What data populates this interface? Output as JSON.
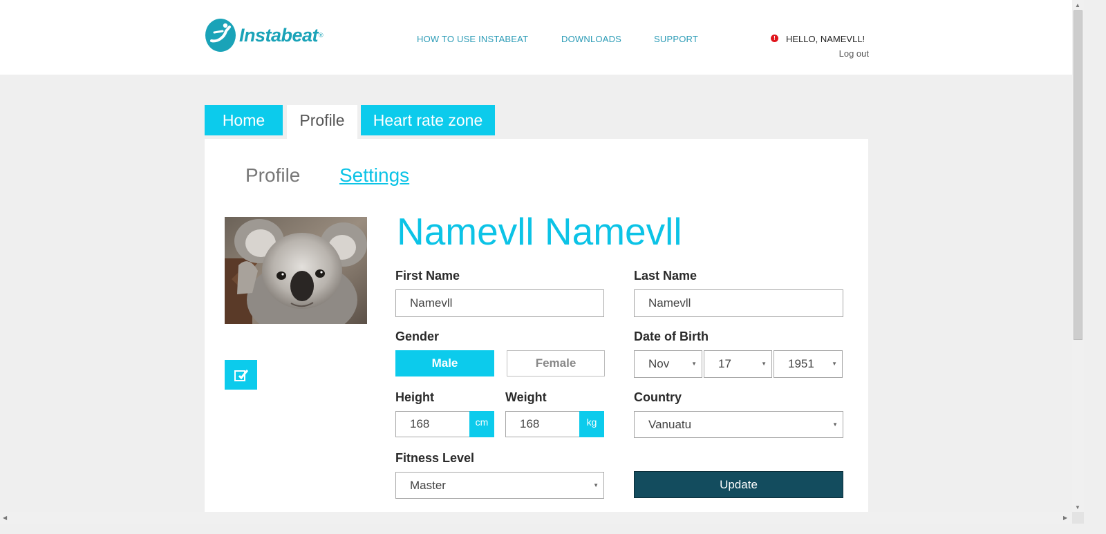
{
  "brand": {
    "name": "Instabeat",
    "reg": "®"
  },
  "nav": {
    "links": [
      "HOW TO USE INSTABEAT",
      "DOWNLOADS",
      "SUPPORT"
    ],
    "greeting": "HELLO, NAMEVLL!",
    "alert_glyph": "!",
    "logout": "Log out"
  },
  "tabs": {
    "home": "Home",
    "profile": "Profile",
    "heart_rate": "Heart rate zone",
    "active": "Profile"
  },
  "subtabs": {
    "profile": "Profile",
    "settings": "Settings"
  },
  "profile": {
    "full_name": "Namevll Namevll",
    "first_name_label": "First Name",
    "first_name": "Namevll",
    "last_name_label": "Last Name",
    "last_name": "Namevll",
    "gender_label": "Gender",
    "gender_options": [
      "Male",
      "Female"
    ],
    "gender_selected": "Male",
    "dob_label": "Date of Birth",
    "dob": {
      "month": "Nov",
      "day": "17",
      "year": "1951"
    },
    "height_label": "Height",
    "height": "168",
    "height_unit": "cm",
    "weight_label": "Weight",
    "weight": "168",
    "weight_unit": "kg",
    "country_label": "Country",
    "country": "Vanuatu",
    "fitness_label": "Fitness Level",
    "fitness": "Master",
    "update_label": "Update"
  },
  "icons": {
    "logo": "instabeat-logo-icon",
    "edit": "edit-icon",
    "alert": "alert-icon",
    "caret": "caret-down-icon"
  },
  "colors": {
    "accent": "#0ccbec",
    "brand": "#1aa3b8",
    "update_button": "#134c5e",
    "alert": "#e0141c"
  }
}
